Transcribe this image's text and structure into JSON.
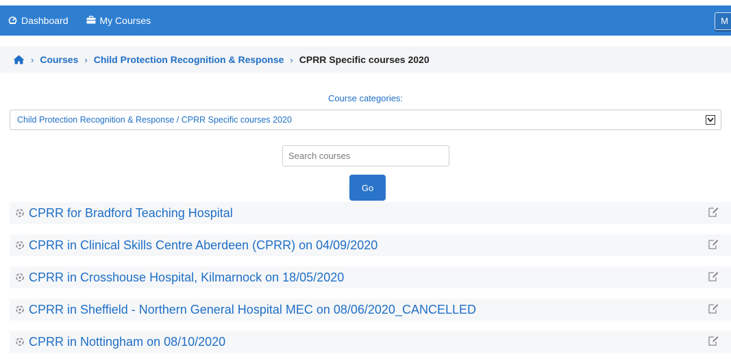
{
  "topbar": {
    "nav": [
      {
        "label": "Dashboard",
        "icon": "dashboard-icon"
      },
      {
        "label": "My Courses",
        "icon": "briefcase-icon"
      }
    ],
    "user_button_label": "M",
    "color": "#2f7fd1"
  },
  "breadcrumb": {
    "home_icon": "home-icon",
    "items": [
      "Courses",
      "Child Protection Recognition & Response"
    ],
    "current": "CPRR Specific courses 2020"
  },
  "categories": {
    "label": "Course categories:",
    "selected": "Child Protection Recognition & Response / CPRR Specific courses 2020"
  },
  "search": {
    "placeholder": "Search courses",
    "value": "",
    "button_label": "Go"
  },
  "courses": [
    {
      "title": "CPRR for Bradford Teaching Hospital",
      "icon": "course-icon",
      "action_icon": "edit-icon"
    },
    {
      "title": "CPRR in Clinical Skills Centre Aberdeen (CPRR) on 04/09/2020",
      "icon": "course-icon",
      "action_icon": "edit-icon"
    },
    {
      "title": "CPRR in Crosshouse Hospital, Kilmarnock on 18/05/2020",
      "icon": "course-icon",
      "action_icon": "edit-icon"
    },
    {
      "title": "CPRR in Sheffield - Northern General Hospital MEC on 08/06/2020_CANCELLED",
      "icon": "course-icon",
      "action_icon": "edit-icon"
    },
    {
      "title": "CPRR in Nottingham on 08/10/2020",
      "icon": "course-icon",
      "action_icon": "edit-icon"
    }
  ]
}
